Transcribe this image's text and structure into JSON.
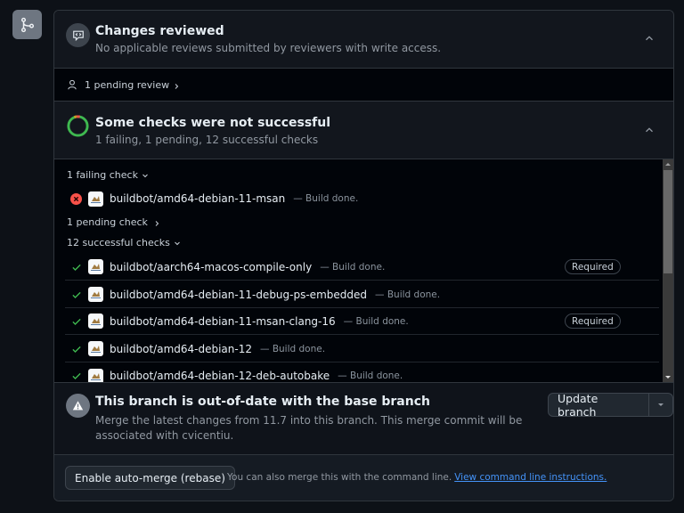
{
  "sidebar": {
    "icon": "git-merge-icon"
  },
  "reviews": {
    "title": "Changes reviewed",
    "subtitle": "No applicable reviews submitted by reviewers with write access.",
    "pending_label": "1 pending review"
  },
  "checks": {
    "title": "Some checks were not successful",
    "subtitle": "1 failing, 1 pending, 12 successful checks",
    "failing_group_label": "1 failing check",
    "pending_group_label": "1 pending check",
    "successful_group_label": "12 successful checks",
    "failing": [
      {
        "name": "buildbot/amd64-debian-11-msan",
        "desc": "— Build done.",
        "status": "failure"
      }
    ],
    "successful": [
      {
        "name": "buildbot/aarch64-macos-compile-only",
        "desc": "— Build done.",
        "required": "Required"
      },
      {
        "name": "buildbot/amd64-debian-11-debug-ps-embedded",
        "desc": "— Build done.",
        "required": null
      },
      {
        "name": "buildbot/amd64-debian-11-msan-clang-16",
        "desc": "— Build done.",
        "required": "Required"
      },
      {
        "name": "buildbot/amd64-debian-12",
        "desc": "— Build done.",
        "required": null
      },
      {
        "name": "buildbot/amd64-debian-12-deb-autobake",
        "desc": "— Build done.",
        "required": null
      }
    ],
    "status_counts": {
      "failing": 1,
      "pending": 1,
      "successful": 12
    }
  },
  "branch": {
    "title": "This branch is out-of-date with the base branch",
    "description": "Merge the latest changes from 11.7 into this branch. This merge commit will be associated with cvicentiu.",
    "update_button": "Update branch"
  },
  "merge": {
    "automerge_button": "Enable auto-merge (rebase)",
    "helper_text": "You can also merge this with the command line.",
    "link_text": "View command line instructions."
  },
  "colors": {
    "success": "#3fb950",
    "failure": "#f85149",
    "pending": "#d29922",
    "link": "#4493f8"
  }
}
